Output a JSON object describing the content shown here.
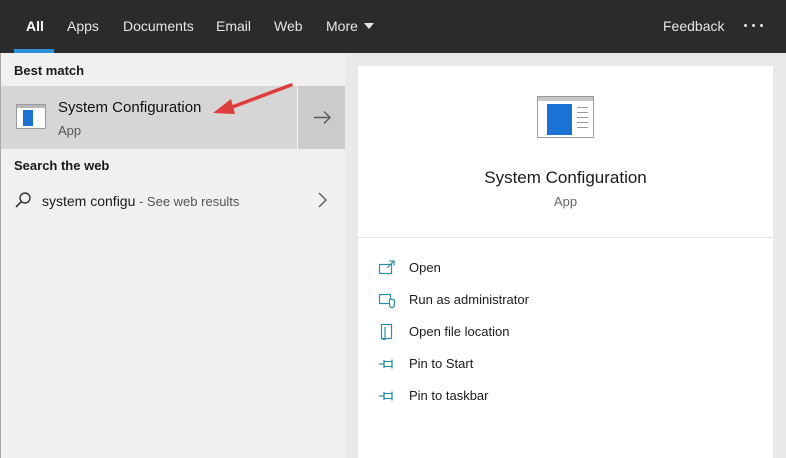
{
  "tabs": [
    {
      "label": "All"
    },
    {
      "label": "Apps"
    },
    {
      "label": "Documents"
    },
    {
      "label": "Email"
    },
    {
      "label": "Web"
    },
    {
      "label": "More"
    }
  ],
  "header": {
    "feedback_label": "Feedback"
  },
  "left": {
    "best_match_header": "Best match",
    "best_match": {
      "title": "System Configuration",
      "subtitle": "App"
    },
    "web_header": "Search the web",
    "web_result": {
      "query": "system configu",
      "suffix": " - See web results"
    }
  },
  "detail": {
    "title": "System Configuration",
    "subtitle": "App",
    "actions": [
      {
        "label": "Open",
        "icon": "open-icon"
      },
      {
        "label": "Run as administrator",
        "icon": "shield-icon"
      },
      {
        "label": "Open file location",
        "icon": "file-location-icon"
      },
      {
        "label": "Pin to Start",
        "icon": "pin-icon"
      },
      {
        "label": "Pin to taskbar",
        "icon": "pin-icon"
      }
    ]
  },
  "colors": {
    "accent": "#2e8fd9",
    "topbar": "#2b2b2b",
    "action_icon": "#2a8fa8",
    "annotation_arrow": "#e03c3c"
  }
}
